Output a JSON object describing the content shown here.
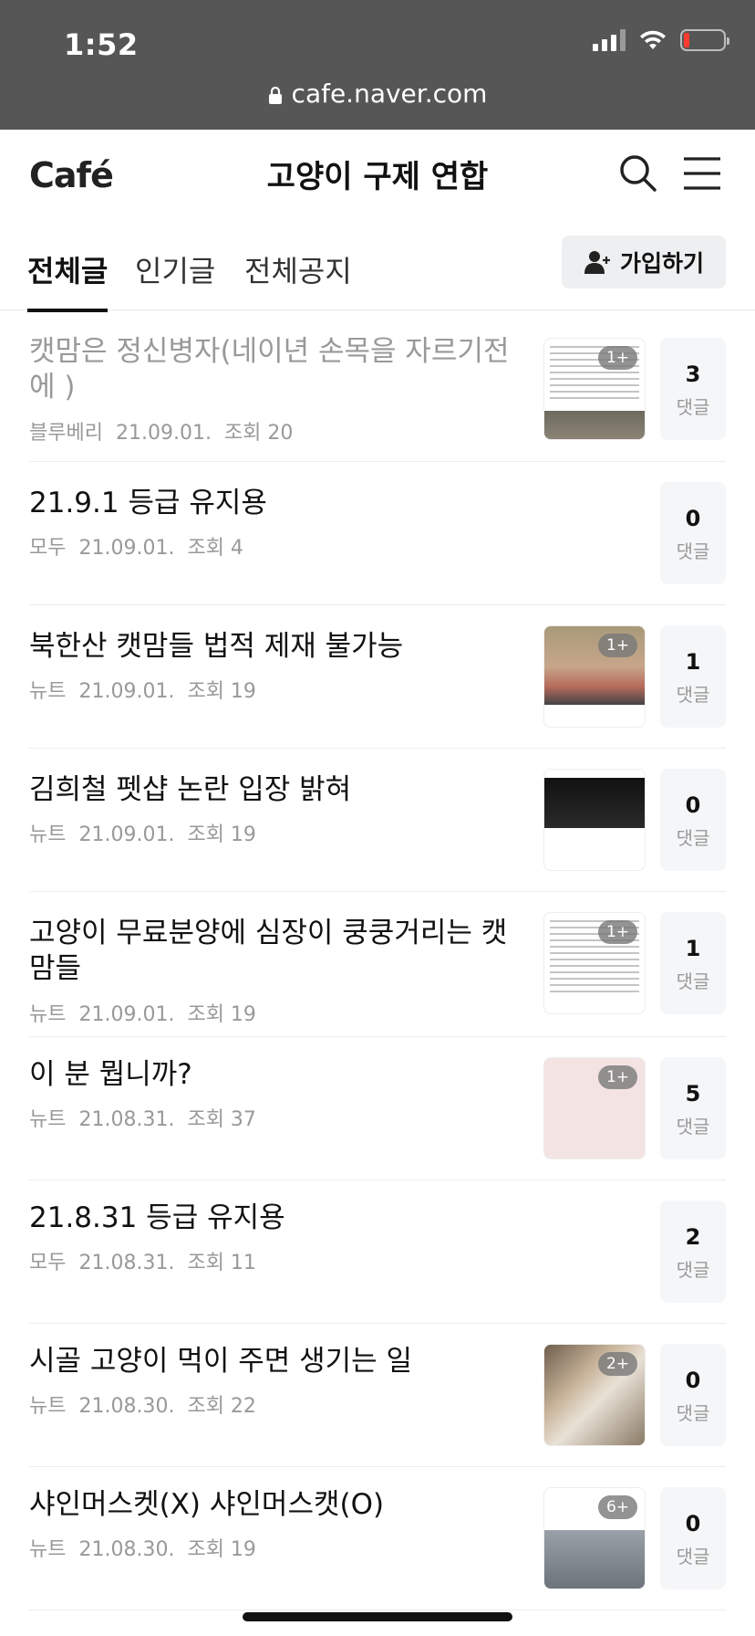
{
  "status_bar": {
    "time": "1:52",
    "url": "cafe.naver.com"
  },
  "header": {
    "logo": "Café",
    "title": "고양이 구제 연합"
  },
  "tabs": [
    {
      "label": "전체글",
      "active": true
    },
    {
      "label": "인기글",
      "active": false
    },
    {
      "label": "전체공지",
      "active": false
    }
  ],
  "join_button": {
    "label": "가입하기"
  },
  "comment_label": "댓글",
  "articles": [
    {
      "title": "캣맘은 정신병자(네이년 손목을 자르기전에 )",
      "author": "블루베리",
      "date": "21.09.01.",
      "views": "조회 20",
      "comments": "3",
      "thumb_badge": "1+",
      "read": true
    },
    {
      "title": "21.9.1 등급 유지용",
      "author": "모두",
      "date": "21.09.01.",
      "views": "조회 4",
      "comments": "0"
    },
    {
      "title": "북한산 캣맘들 법적 제재 불가능",
      "author": "뉴트",
      "date": "21.09.01.",
      "views": "조회 19",
      "comments": "1",
      "thumb_badge": "1+"
    },
    {
      "title": "김희철 펫샵 논란 입장 밝혀",
      "author": "뉴트",
      "date": "21.09.01.",
      "views": "조회 19",
      "comments": "0"
    },
    {
      "title": "고양이 무료분양에 심장이 쿵쿵거리는 캣맘들",
      "author": "뉴트",
      "date": "21.09.01.",
      "views": "조회 19",
      "comments": "1",
      "thumb_badge": "1+"
    },
    {
      "title": "이 분 뭡니까?",
      "author": "뉴트",
      "date": "21.08.31.",
      "views": "조회 37",
      "comments": "5",
      "thumb_badge": "1+"
    },
    {
      "title": "21.8.31 등급 유지용",
      "author": "모두",
      "date": "21.08.31.",
      "views": "조회 11",
      "comments": "2"
    },
    {
      "title": "시골 고양이 먹이 주면 생기는 일",
      "author": "뉴트",
      "date": "21.08.30.",
      "views": "조회 22",
      "comments": "0",
      "thumb_badge": "2+"
    },
    {
      "title": "샤인머스켓(X) 샤인머스캣(O)",
      "author": "뉴트",
      "date": "21.08.30.",
      "views": "조회 19",
      "comments": "0",
      "thumb_badge": "6+"
    }
  ]
}
